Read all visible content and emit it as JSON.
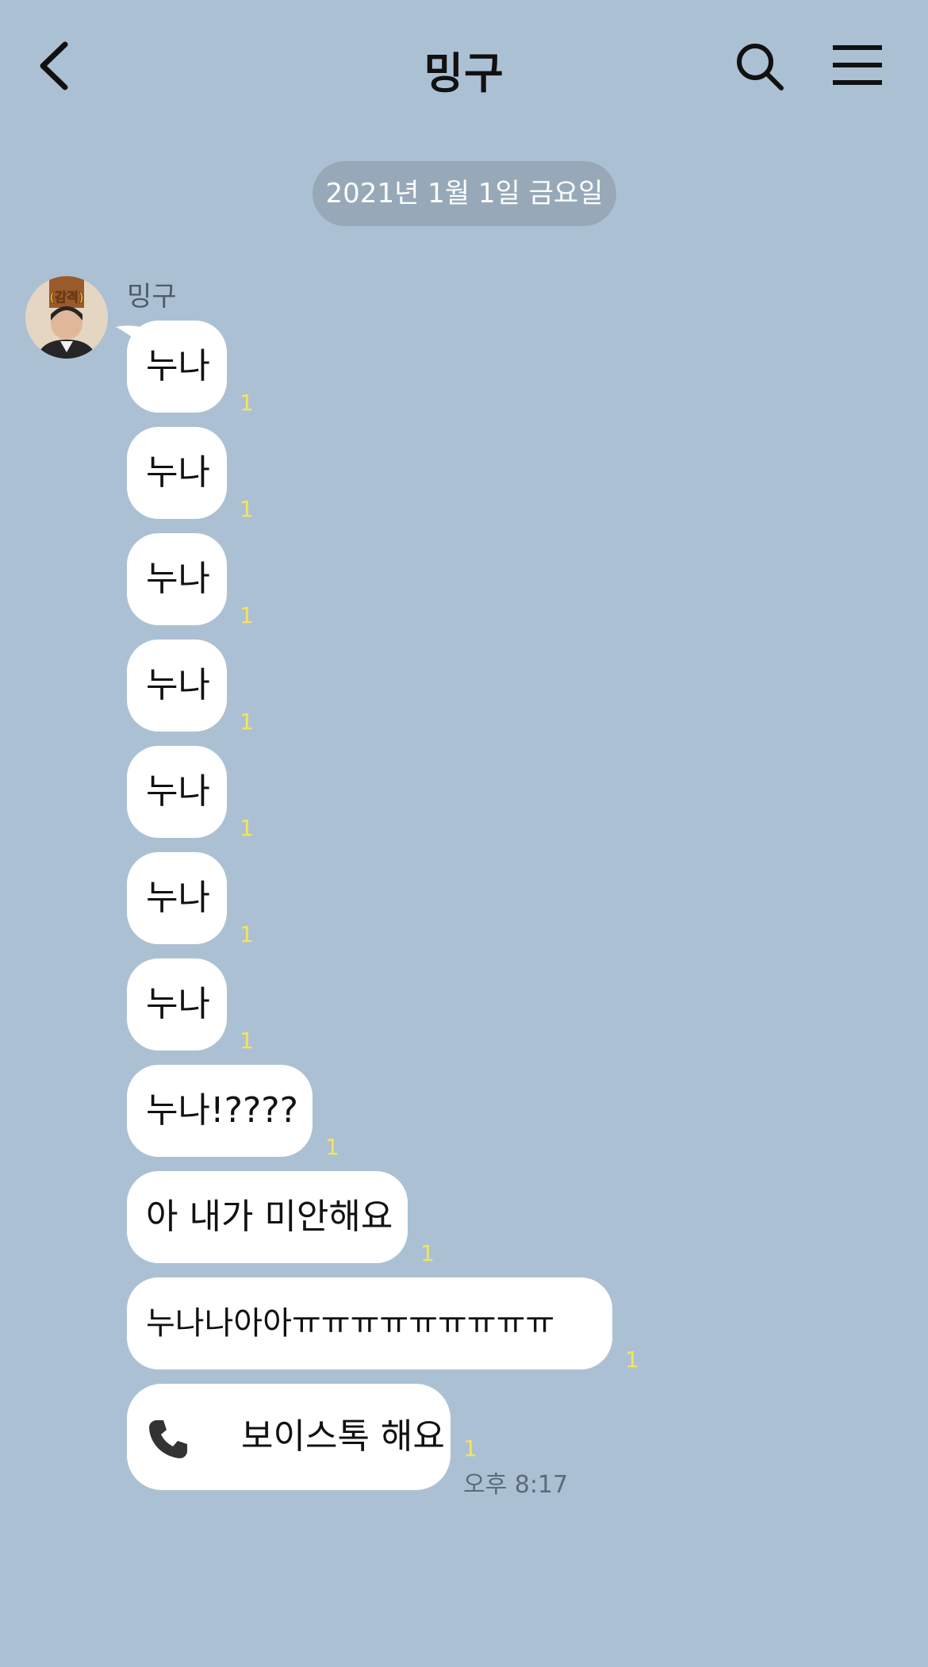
{
  "header": {
    "title": "밍구",
    "back_icon": "chevron-left-icon",
    "search_icon": "search-icon",
    "menu_icon": "hamburger-menu-icon"
  },
  "date_divider": "2021년 1월 1일 금요일",
  "chat": {
    "sender_name": "밍구",
    "avatar_sticker_text": "(감격)",
    "messages": [
      {
        "text": "누나",
        "unread": "1"
      },
      {
        "text": "누나",
        "unread": "1"
      },
      {
        "text": "누나",
        "unread": "1"
      },
      {
        "text": "누나",
        "unread": "1"
      },
      {
        "text": "누나",
        "unread": "1"
      },
      {
        "text": "누나",
        "unread": "1"
      },
      {
        "text": "누나",
        "unread": "1"
      },
      {
        "text": "누나!????",
        "unread": "1"
      },
      {
        "text": "아 내가 미안해요",
        "unread": "1"
      },
      {
        "text": "누나나아아ㅠㅠㅠㅠㅠㅠㅠㅠㅠ",
        "unread": "1"
      }
    ],
    "voice_call": {
      "icon": "phone-icon",
      "text": "보이스톡 해요",
      "unread": "1",
      "time": "오후 8:17"
    }
  },
  "colors": {
    "background": "#abc1d3",
    "bubble": "#ffffff",
    "unread": "#f7e35c",
    "date_pill": "#97a9b8"
  }
}
